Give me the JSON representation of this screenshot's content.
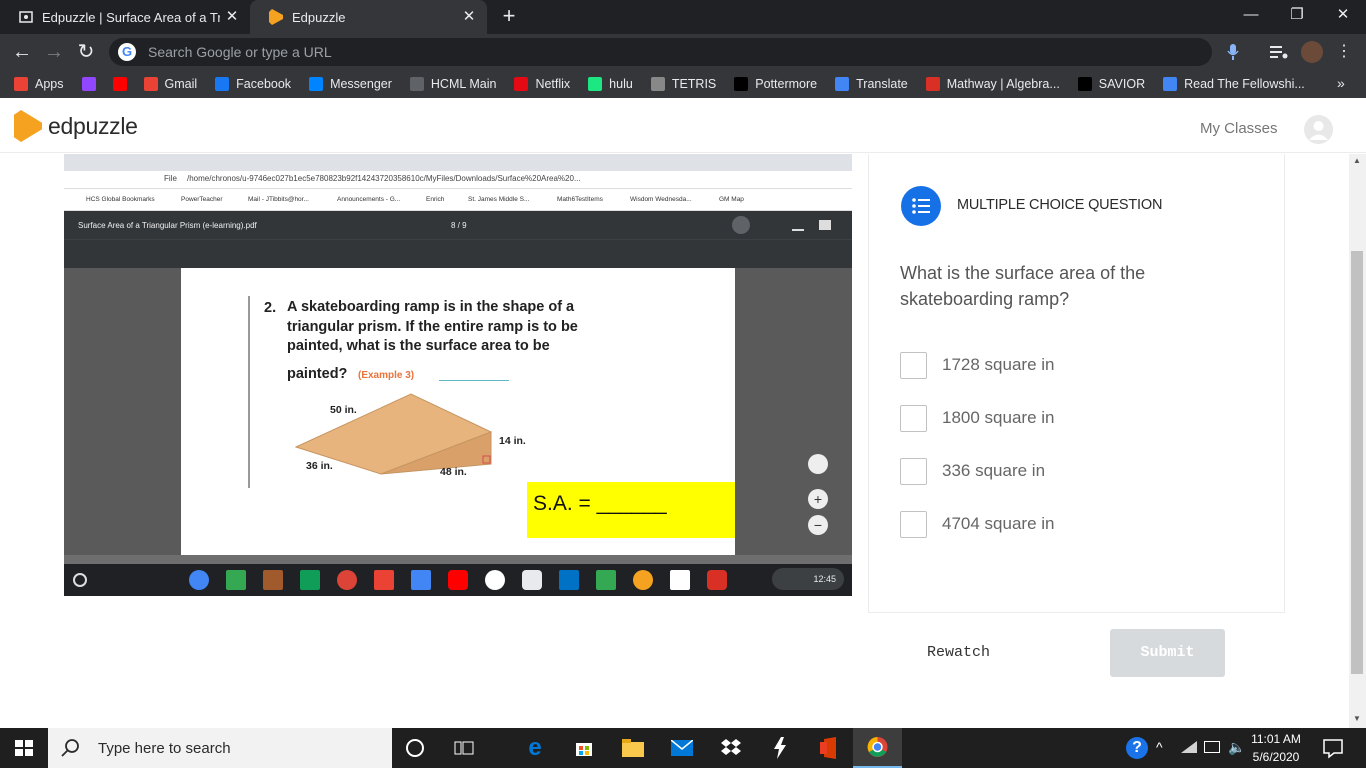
{
  "browser": {
    "tabs": [
      {
        "title": "Edpuzzle | Surface Area of a Trian",
        "active": false
      },
      {
        "title": "Edpuzzle",
        "active": true
      }
    ],
    "new_tab": "+",
    "window_controls": {
      "minimize": "—",
      "restore": "❐",
      "close": "✕"
    },
    "nav": {
      "back": "←",
      "forward": "→",
      "reload": "↻"
    },
    "omnibox_placeholder": "Search Google or type a URL",
    "omnibox_g": "G",
    "bookmarks": [
      {
        "label": "Apps",
        "icon": "apps-grid-icon",
        "color": "#ea4335"
      },
      {
        "label": "",
        "icon": "twitch-icon",
        "color": "#9146ff"
      },
      {
        "label": "",
        "icon": "youtube-icon",
        "color": "#ff0000"
      },
      {
        "label": "Gmail",
        "icon": "gmail-icon",
        "color": "#ea4335"
      },
      {
        "label": "Facebook",
        "icon": "facebook-icon",
        "color": "#1877f2"
      },
      {
        "label": "Messenger",
        "icon": "messenger-icon",
        "color": "#0084ff"
      },
      {
        "label": "HCML Main",
        "icon": "hcml-icon",
        "color": "#5f6368"
      },
      {
        "label": "Netflix",
        "icon": "netflix-icon",
        "color": "#e50914"
      },
      {
        "label": "hulu",
        "icon": "hulu-icon",
        "color": "#1ce783"
      },
      {
        "label": "TETRIS",
        "icon": "tetris-icon",
        "color": "#888888"
      },
      {
        "label": "Pottermore",
        "icon": "pottermore-icon",
        "color": "#000000"
      },
      {
        "label": "Translate",
        "icon": "translate-icon",
        "color": "#4285f4"
      },
      {
        "label": "Mathway | Algebra...",
        "icon": "mathway-icon",
        "color": "#d93025"
      },
      {
        "label": "SAVIOR",
        "icon": "savior-icon",
        "color": "#000000"
      },
      {
        "label": "Read The Fellowshi...",
        "icon": "book-icon",
        "color": "#4285f4"
      }
    ],
    "bookmarks_more": "»"
  },
  "edpuzzle": {
    "logo_text": "edpuzzle",
    "my_classes": "My Classes"
  },
  "video": {
    "address": "/home/chronos/u-9746ec027b1ec5e780823b92f14243720358610c/MyFiles/Downloads/Surface%20Area%20...",
    "file_label": "File",
    "inner_bookmarks": [
      "HCS Global Bookmarks",
      "PowerTeacher",
      "Mail - JTibbits@hor...",
      "Announcements - G...",
      "Enrich",
      "St. James Middle S...",
      "Math6TestItems",
      "Wisdom Wednesda...",
      "GM Map"
    ],
    "pdf_title": "Surface Area of a Triangular Prism (e-learning).pdf",
    "pdf_page": "8 / 9",
    "problem_number": "2.",
    "problem_text": "A skateboarding ramp is in the shape of a triangular prism. If the entire ramp is to be painted, what is the surface area to be",
    "problem_text_end": "painted?",
    "example_ref": "(Example 3)",
    "dims": {
      "top": "50 in.",
      "height": "14 in.",
      "left": "36 in.",
      "bottom": "48 in."
    },
    "sa_label": "S.A. = ______",
    "shelf_time": "12:45"
  },
  "question": {
    "type_label": "MULTIPLE CHOICE QUESTION",
    "text": "What is the surface area of the skateboarding ramp?",
    "options": [
      {
        "label": "1728 square in",
        "checked": false
      },
      {
        "label": "1800 square in",
        "checked": false
      },
      {
        "label": "336 square in",
        "checked": false
      },
      {
        "label": "4704 square in",
        "checked": false
      }
    ]
  },
  "actions": {
    "rewatch": "Rewatch",
    "submit": "Submit"
  },
  "taskbar": {
    "search_placeholder": "Type here to search",
    "time": "11:01 AM",
    "date": "5/6/2020"
  },
  "colors": {
    "accent": "#1771e6",
    "logo": "#f4a21f",
    "submit_disabled": "#d7dadd",
    "sa_highlight": "#ffff00",
    "ramp": "#e8b47e"
  }
}
